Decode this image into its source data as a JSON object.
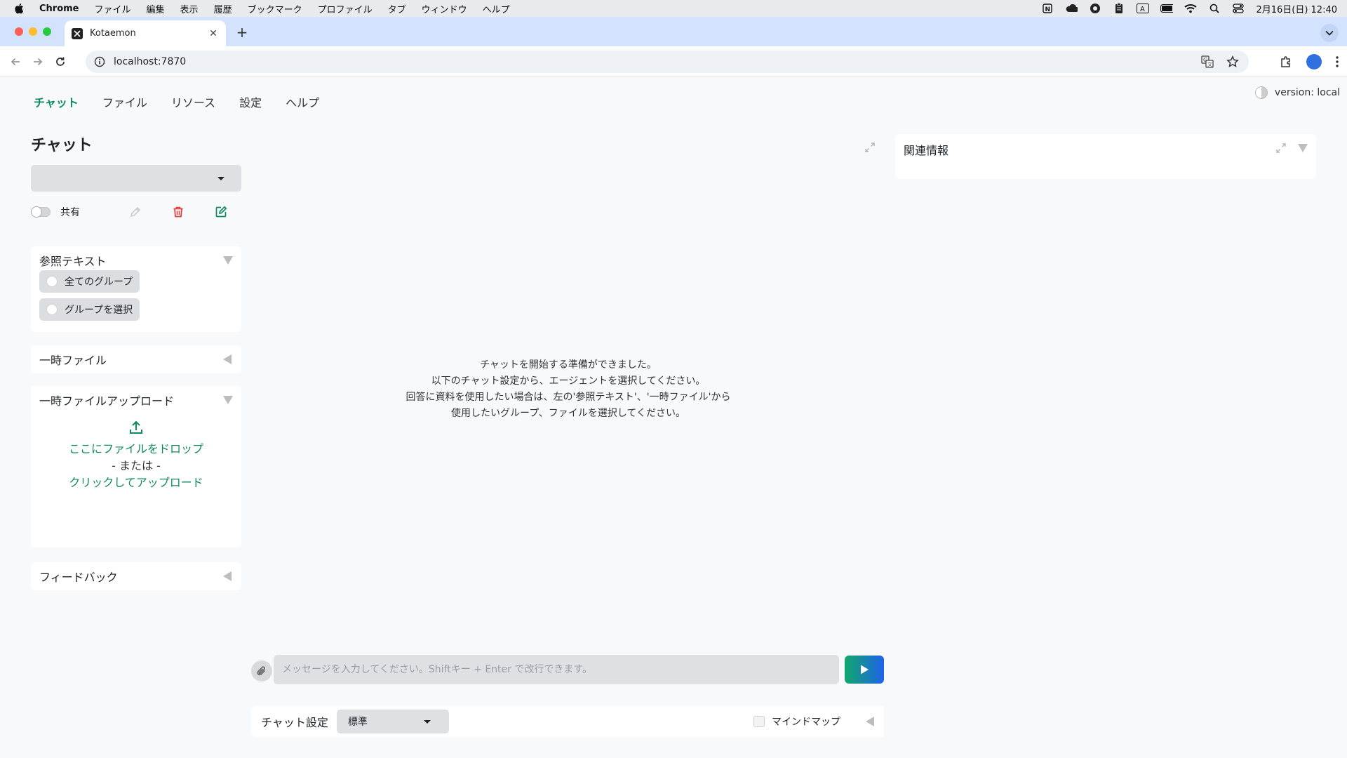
{
  "menubar": {
    "items": [
      "Chrome",
      "ファイル",
      "編集",
      "表示",
      "履歴",
      "ブックマーク",
      "プロファイル",
      "タブ",
      "ウィンドウ",
      "ヘルプ"
    ],
    "datetime": "2月16日(日)  12:40"
  },
  "browser": {
    "tab_title": "Kotaemon",
    "url": "localhost:7870"
  },
  "app": {
    "nav": [
      "チャット",
      "ファイル",
      "リソース",
      "設定",
      "ヘルプ"
    ],
    "version": "version: local",
    "page_title": "チャット",
    "share_label": "共有",
    "reference_panel": {
      "title": "参照テキスト",
      "options": [
        "全てのグループ",
        "グループを選択"
      ]
    },
    "temp_files_title": "一時ファイル",
    "upload_panel": {
      "title": "一時ファイルアップロード",
      "drop": "ここにファイルをドロップ",
      "or": "- または -",
      "click": "クリックしてアップロード"
    },
    "feedback_title": "フィードバック",
    "main_message": [
      "チャットを開始する準備ができました。",
      "以下のチャット設定から、エージェントを選択してください。",
      "回答に資料を使用したい場合は、左の'参照テキスト'、'一時ファイル'から",
      "使用したいグループ、ファイルを選択してください。"
    ],
    "related_title": "関連情報",
    "input_placeholder": "メッセージを入力してください。Shiftキー + Enter で改行できます。",
    "chat_settings_label": "チャット設定",
    "mode_value": "標準",
    "mindmap_label": "マインドマップ"
  },
  "colors": {
    "accent": "#0f8a5f",
    "delete": "#e53935",
    "send_start": "#10a86b",
    "send_end": "#1e63e9"
  }
}
